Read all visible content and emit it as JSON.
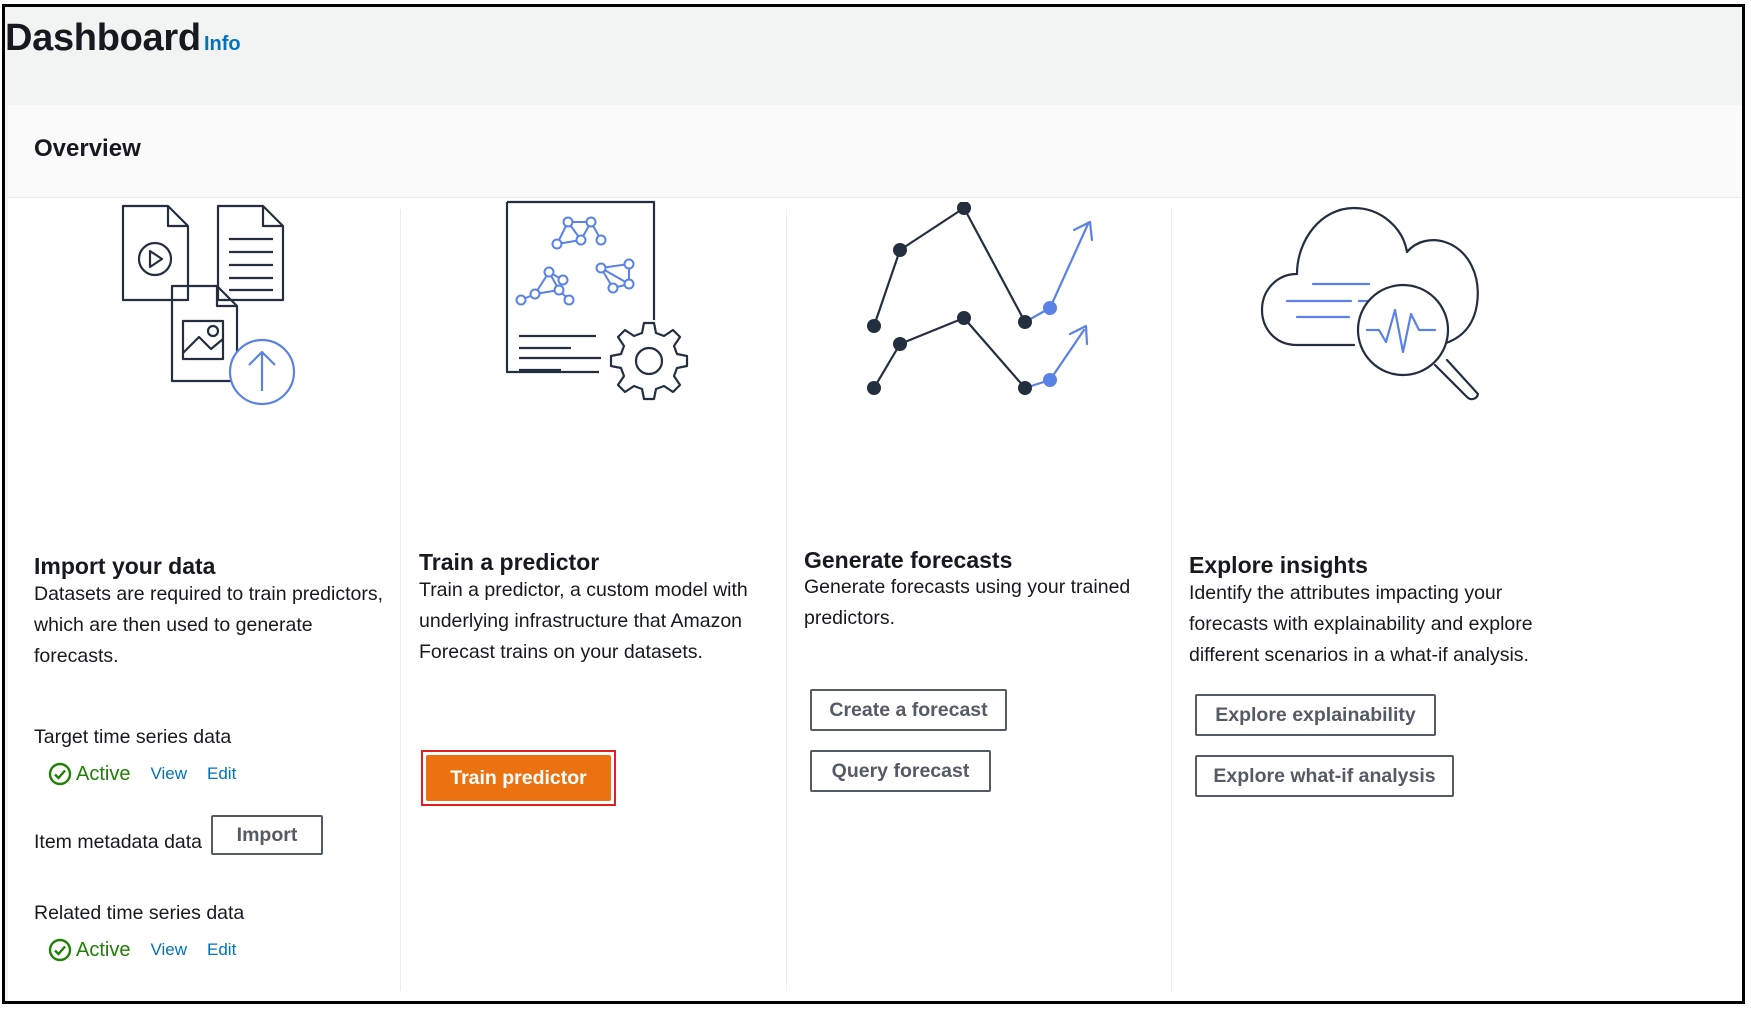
{
  "header": {
    "title": "Dashboard",
    "info_link": "Info"
  },
  "overview": {
    "title": "Overview"
  },
  "columns": {
    "import": {
      "illustration": "import-data-icon",
      "heading": "Import your data",
      "description": "Datasets are required to train predictors, which are then used to generate forecasts.",
      "datasets": {
        "target": {
          "label": "Target time series data",
          "status": "Active",
          "view": "View",
          "edit": "Edit"
        },
        "item_metadata": {
          "label": "Item metadata data",
          "import_button": "Import"
        },
        "related": {
          "label": "Related time series data",
          "status": "Active",
          "view": "View",
          "edit": "Edit"
        }
      }
    },
    "train": {
      "illustration": "train-predictor-icon",
      "heading": "Train a predictor",
      "description": "Train a predictor, a custom model with underlying infrastructure that Amazon Forecast trains on your datasets.",
      "button": "Train predictor"
    },
    "forecast": {
      "illustration": "forecast-chart-icon",
      "heading": "Generate forecasts",
      "description": "Generate forecasts using your trained predictors.",
      "create_button": "Create a forecast",
      "query_button": "Query forecast"
    },
    "insights": {
      "illustration": "cloud-insights-icon",
      "heading": "Explore insights",
      "description": "Identify the attributes impacting your forecasts with explainability and explore different scenarios in a what-if analysis.",
      "explainability_button": "Explore explainability",
      "whatif_button": "Explore what-if analysis"
    }
  },
  "colors": {
    "primary": "#ec7211",
    "link": "#0073bb",
    "success": "#1d8102",
    "illustration_accent": "#5a82e6",
    "highlight": "#e02020"
  }
}
